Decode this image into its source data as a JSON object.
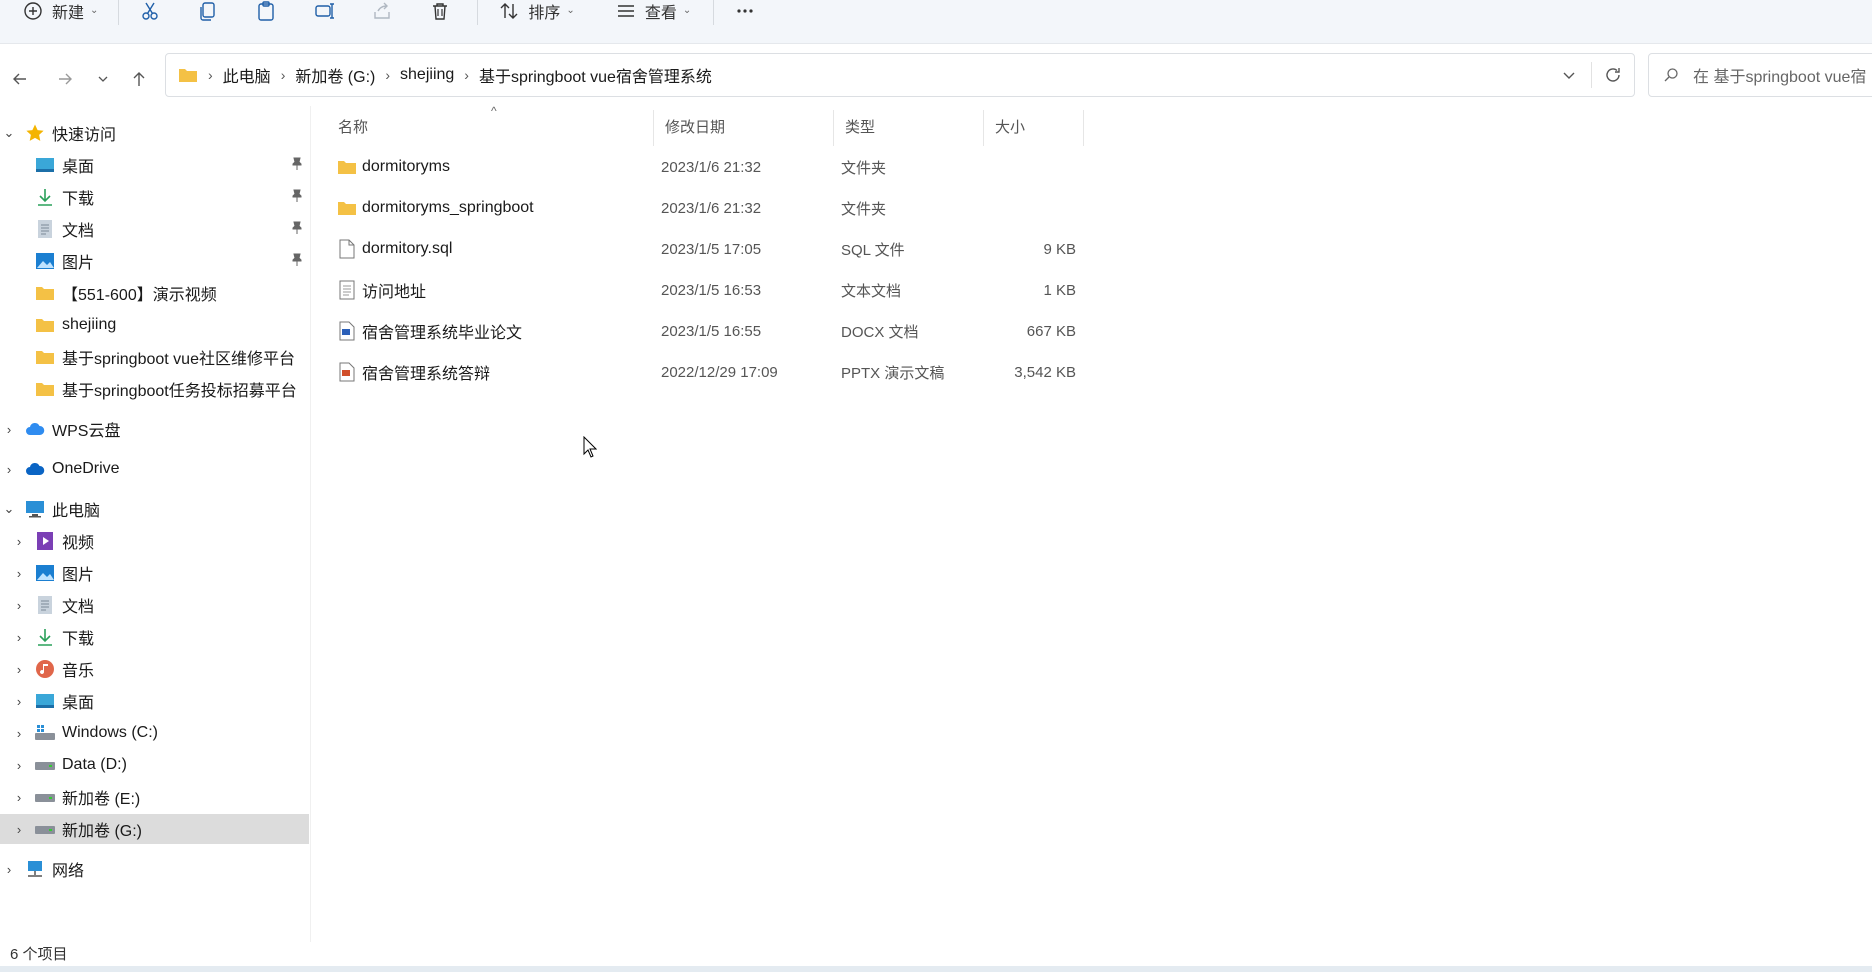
{
  "toolbar": {
    "new_label": "新建",
    "sort_label": "排序",
    "view_label": "查看"
  },
  "breadcrumb": [
    "此电脑",
    "新加卷 (G:)",
    "shejiing",
    "基于springboot vue宿舍管理系统"
  ],
  "search": {
    "placeholder": "在 基于springboot vue宿"
  },
  "sidebar": {
    "quick_access": {
      "label": "快速访问",
      "items": [
        {
          "label": "桌面",
          "icon": "desktop-icon",
          "pinned": true
        },
        {
          "label": "下载",
          "icon": "download-icon",
          "pinned": true
        },
        {
          "label": "文档",
          "icon": "document-icon",
          "pinned": true
        },
        {
          "label": "图片",
          "icon": "pictures-icon",
          "pinned": true
        },
        {
          "label": "【551-600】演示视频",
          "icon": "folder-icon",
          "pinned": false
        },
        {
          "label": "shejiing",
          "icon": "folder-icon",
          "pinned": false
        },
        {
          "label": "基于springboot vue社区维修平台",
          "icon": "folder-icon",
          "pinned": false
        },
        {
          "label": "基于springboot任务投标招募平台",
          "icon": "folder-icon",
          "pinned": false
        }
      ]
    },
    "wps": {
      "label": "WPS云盘"
    },
    "onedrive": {
      "label": "OneDrive"
    },
    "this_pc": {
      "label": "此电脑",
      "items": [
        {
          "label": "视频",
          "icon": "video-icon"
        },
        {
          "label": "图片",
          "icon": "pictures-icon"
        },
        {
          "label": "文档",
          "icon": "document-icon"
        },
        {
          "label": "下载",
          "icon": "download-icon"
        },
        {
          "label": "音乐",
          "icon": "music-icon"
        },
        {
          "label": "桌面",
          "icon": "desktop-icon"
        },
        {
          "label": "Windows (C:)",
          "icon": "windows-drive-icon"
        },
        {
          "label": "Data (D:)",
          "icon": "drive-icon"
        },
        {
          "label": "新加卷 (E:)",
          "icon": "drive-icon"
        },
        {
          "label": "新加卷 (G:)",
          "icon": "drive-icon",
          "selected": true
        }
      ]
    },
    "network": {
      "label": "网络"
    }
  },
  "columns": {
    "name": "名称",
    "date": "修改日期",
    "type": "类型",
    "size": "大小"
  },
  "files": [
    {
      "name": "dormitoryms",
      "date": "2023/1/6 21:32",
      "type": "文件夹",
      "size": "",
      "icon": "folder-icon"
    },
    {
      "name": "dormitoryms_springboot",
      "date": "2023/1/6 21:32",
      "type": "文件夹",
      "size": "",
      "icon": "folder-icon"
    },
    {
      "name": "dormitory.sql",
      "date": "2023/1/5 17:05",
      "type": "SQL 文件",
      "size": "9 KB",
      "icon": "file-icon"
    },
    {
      "name": "访问地址",
      "date": "2023/1/5 16:53",
      "type": "文本文档",
      "size": "1 KB",
      "icon": "text-file-icon"
    },
    {
      "name": "宿舍管理系统毕业论文",
      "date": "2023/1/5 16:55",
      "type": "DOCX 文档",
      "size": "667 KB",
      "icon": "docx-icon"
    },
    {
      "name": "宿舍管理系统答辩",
      "date": "2022/12/29 17:09",
      "type": "PPTX 演示文稿",
      "size": "3,542 KB",
      "icon": "pptx-icon"
    }
  ],
  "status": {
    "item_count": "6 个项目"
  },
  "colors": {
    "accent": "#0067c0",
    "folder": "#f4c145",
    "selected": "#dcdcdc"
  }
}
